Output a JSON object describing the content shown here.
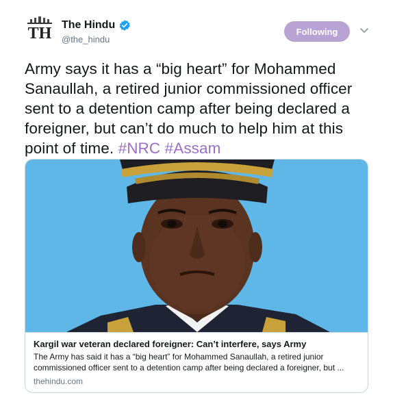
{
  "account": {
    "display_name": "The Hindu",
    "handle": "@the_hindu",
    "avatar_text": "TH",
    "verified_icon": "verified-badge-icon"
  },
  "follow_button": {
    "label": "Following"
  },
  "tweet": {
    "text": "Army says it has a “big heart” for Mohammed Sanaullah, a retired junior commissioned officer sent to a detention camp after being declared a foreigner, but can’t do much to help him at this point of time.",
    "hashtag1": "#NRC",
    "hashtag2": "#Assam"
  },
  "card": {
    "title": "Kargil war veteran declared foreigner: Can’t interfere, says Army",
    "description": "The Army has said it has a “big heart” for Mohammed Sanaullah, a retired junior commissioned officer sent to a detention camp after being declared a foreigner, but ...",
    "domain": "thehindu.com"
  },
  "colors": {
    "follow_button_bg": "#b9a3d4",
    "hashtag": "#9b6fc9",
    "verified": "#1da1f2",
    "image_sky": "#5fb7e8"
  }
}
